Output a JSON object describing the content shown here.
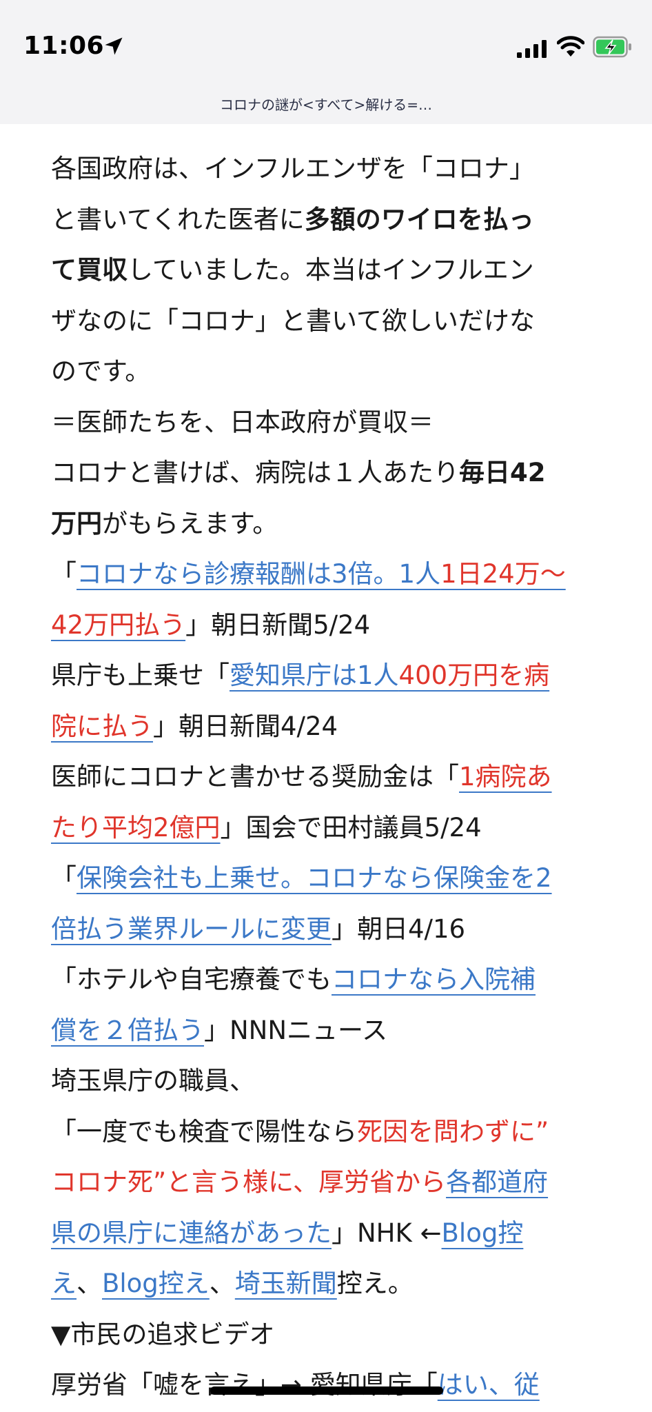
{
  "status_bar": {
    "time": "11:06",
    "icons": [
      "location-arrow-icon",
      "cellular-signal-icon",
      "wifi-icon",
      "battery-charging-icon"
    ]
  },
  "header": {
    "title": "コロナの謎が<すべて>解ける=…"
  },
  "article": {
    "p1": {
      "l1": "各国政府は、インフルエンザを「コロナ」",
      "l2_a": "と書いてくれた医者に",
      "l2_b": "多額のワイロを払っ",
      "l3_a": "て買収",
      "l3_b": "していました。本当はインフルエン",
      "l4": "ザなのに「コロナ」と書いて欲しいだけな",
      "l5": "のです。"
    },
    "l6": "＝医師たちを、日本政府が買収＝",
    "l7_a": "コロナと書けば、病院は１人あたり",
    "l7_b": "毎日42",
    "l8_a": "万円",
    "l8_b": "がもらえます。",
    "l9": {
      "open": "「",
      "link_a": "コロナなら診療報酬は3倍。1人",
      "link_b": "1日24万〜",
      "link_c": "42万円払う",
      "close": "」朝日新聞5/24"
    },
    "l11": {
      "pre": "県庁も上乗せ「",
      "link_a": "愛知県庁は1人",
      "link_b": "400万円を病",
      "link_c": "院に払う",
      "close": "」朝日新聞4/24"
    },
    "l13": {
      "pre": "医師にコロナと書かせる奨励金は「",
      "link_a": "1病院あ",
      "link_b": "たり平均2億円",
      "close": "」国会で田村議員5/24"
    },
    "l15": {
      "open": "「",
      "link_a": "保険会社も上乗せ。コロナなら保険金を2",
      "link_b": "倍払う業界ルールに変更",
      "close": "」朝日4/16"
    },
    "l17": {
      "pre": "「ホテルや自宅療養でも",
      "link_a": "コロナなら入院補",
      "link_b": "償を２倍払う",
      "close": "」NNNニュース"
    },
    "l19": "埼玉県庁の職員、",
    "l20": {
      "pre": "「一度でも検査で陽性なら",
      "red_a": "死因を問わずに”",
      "red_b": "コロナ死”と言う様に、厚労省から",
      "link_a": "各都道府",
      "link_b": "県の県庁に連絡があった",
      "mid": "」NHK ←",
      "link_c": "Blog控",
      "link_d": "え",
      "sep1": "、",
      "link_e": "Blog控え",
      "sep2": "、",
      "link_f": "埼玉新聞",
      "tail": "控え。"
    },
    "l24": "▼市民の追求ビデオ",
    "l25": {
      "pre": "厚労省「嘘を言え」→ 愛知県庁「",
      "link": "はい、従"
    }
  }
}
